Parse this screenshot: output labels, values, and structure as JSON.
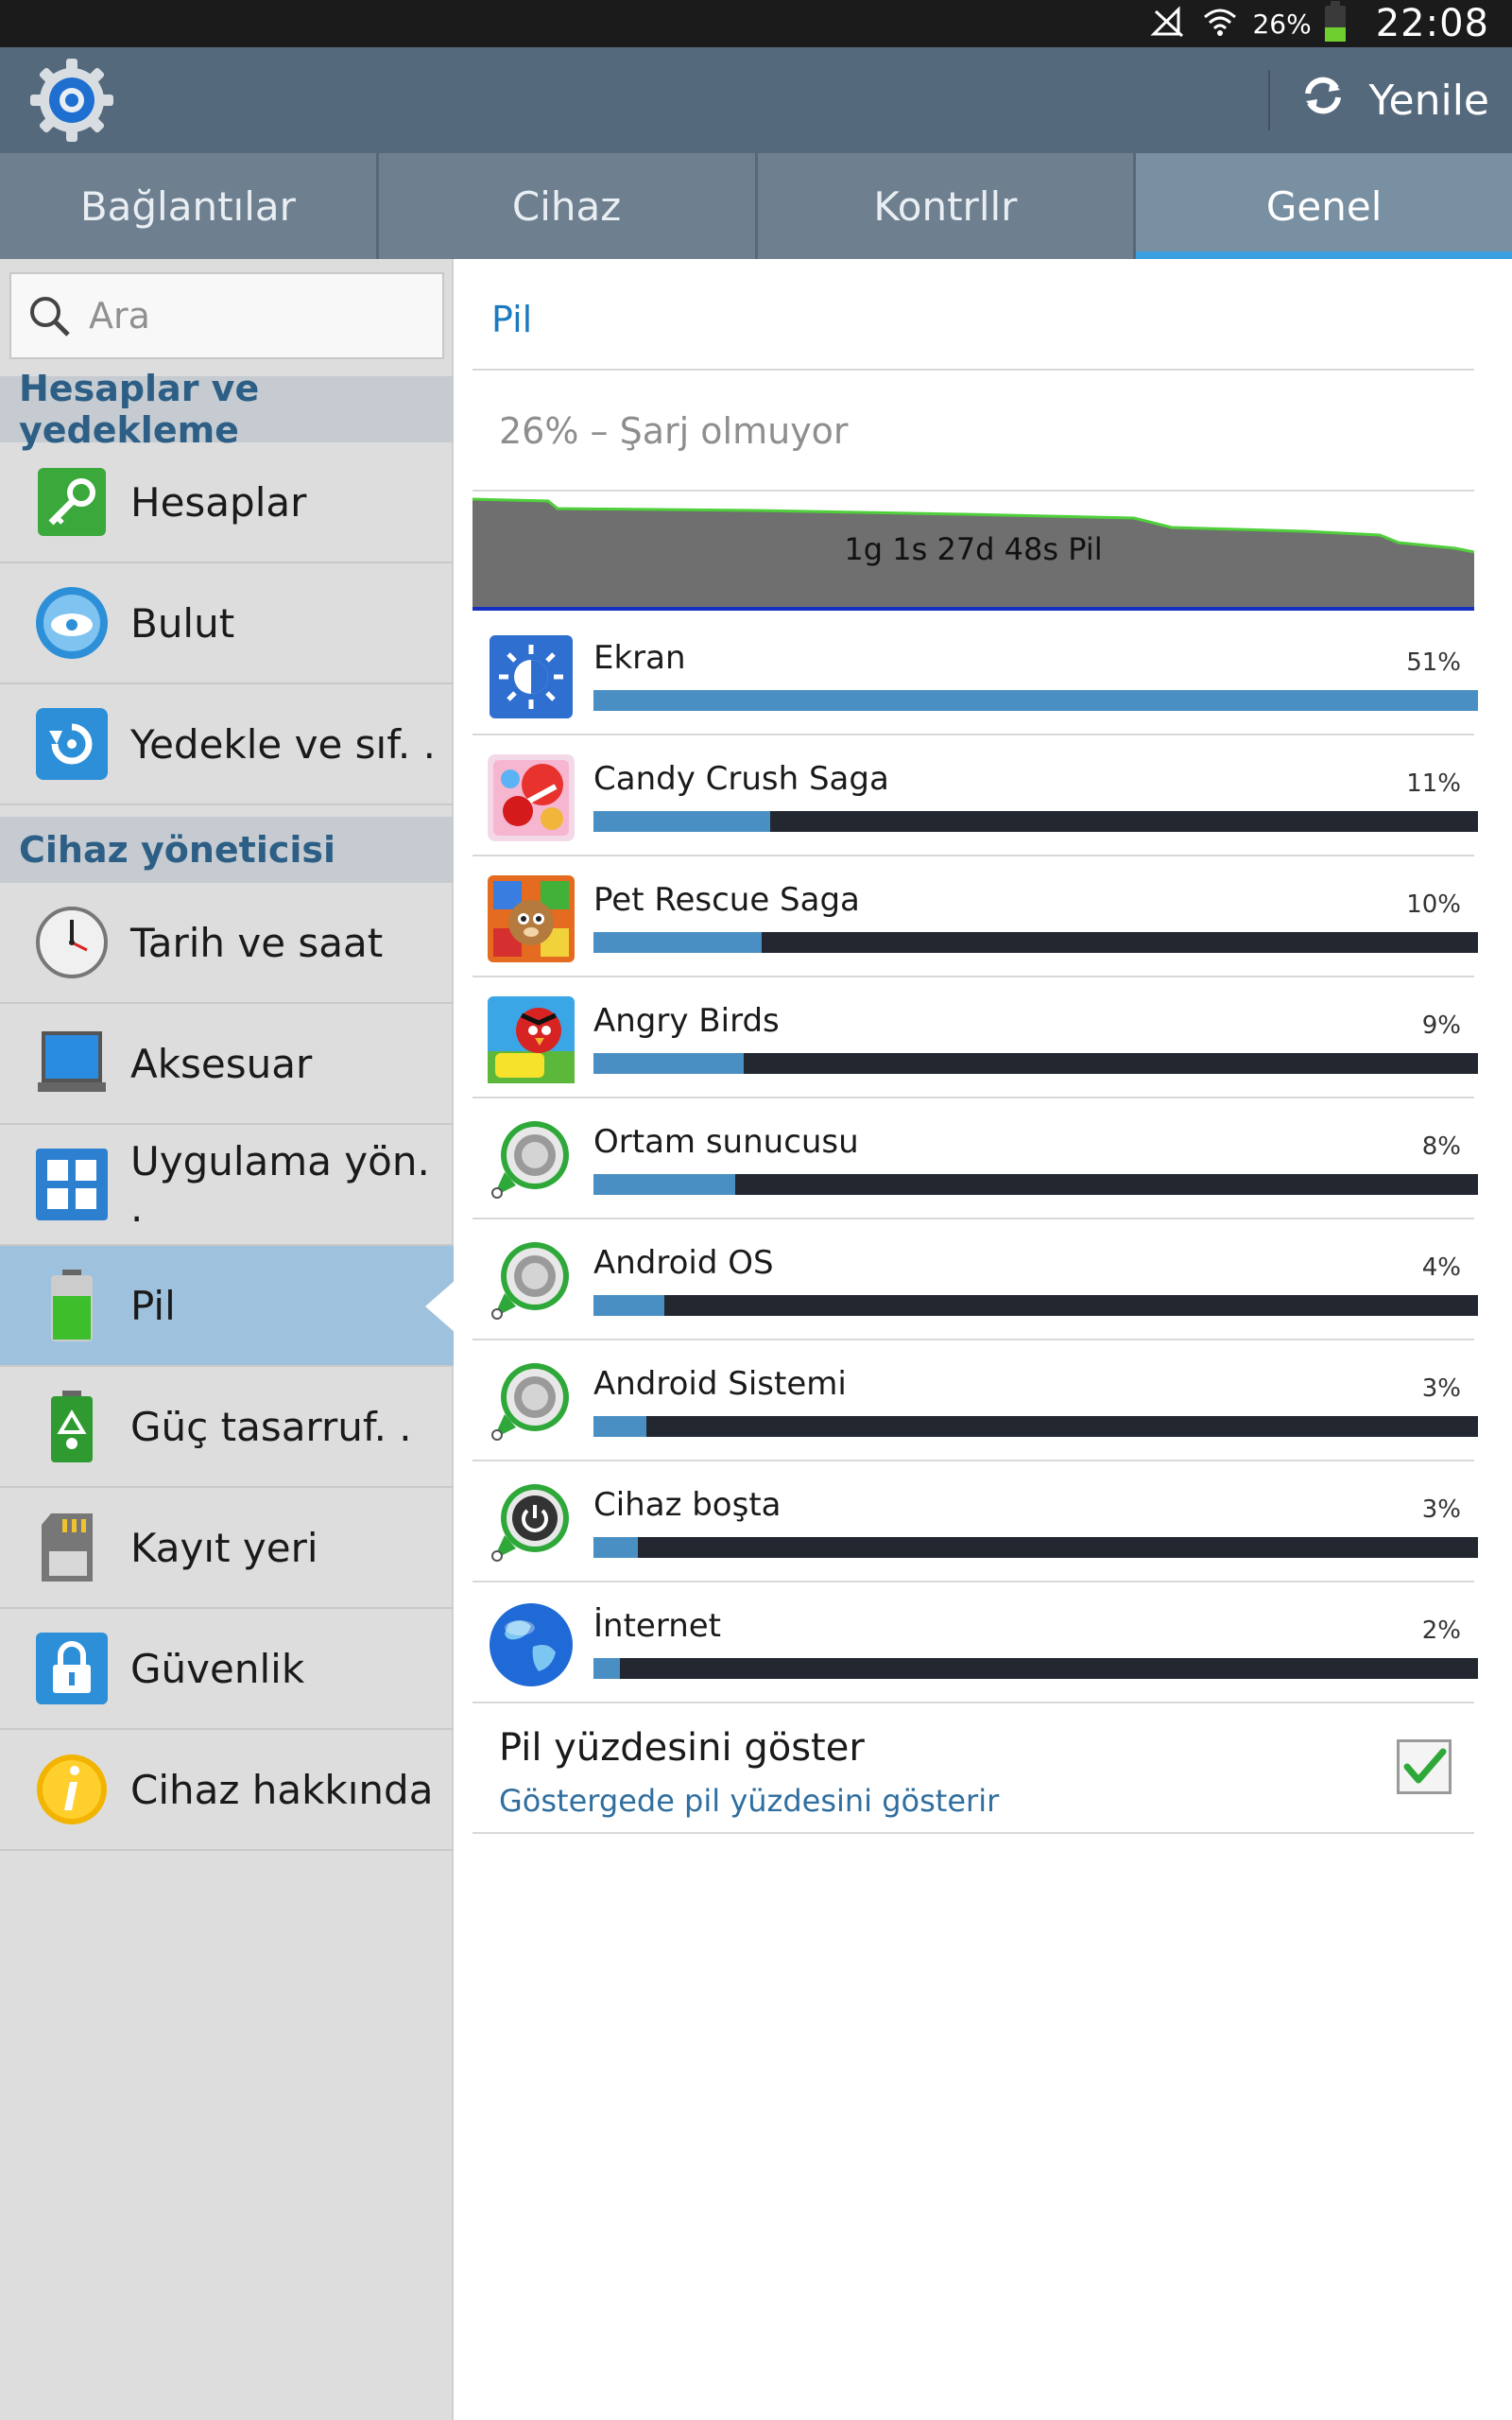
{
  "status_bar": {
    "battery_percent": "26%",
    "time": "22:08"
  },
  "action_bar": {
    "refresh_label": "Yenile"
  },
  "tabs": [
    {
      "label": "Bağlantılar"
    },
    {
      "label": "Cihaz"
    },
    {
      "label": "Kontrllr"
    },
    {
      "label": "Genel"
    }
  ],
  "search": {
    "placeholder": "Ara"
  },
  "sidebar": {
    "section1": "Hesaplar ve yedekleme",
    "section2": "Cihaz yöneticisi",
    "items": [
      {
        "label": "Hesaplar",
        "icon": "key-icon"
      },
      {
        "label": "Bulut",
        "icon": "cloud-icon"
      },
      {
        "label": "Yedekle ve sıf. .",
        "icon": "backup-icon"
      },
      {
        "label": "Tarih ve saat",
        "icon": "clock-icon"
      },
      {
        "label": "Aksesuar",
        "icon": "accessory-icon"
      },
      {
        "label": "Uygulama yön. .",
        "icon": "apps-icon"
      },
      {
        "label": "Pil",
        "icon": "battery-icon"
      },
      {
        "label": "Güç tasarruf. .",
        "icon": "power-saving-icon"
      },
      {
        "label": "Kayıt yeri",
        "icon": "storage-icon"
      },
      {
        "label": "Güvenlik",
        "icon": "lock-icon"
      },
      {
        "label": "Cihaz hakkında",
        "icon": "info-icon"
      }
    ]
  },
  "content": {
    "title": "Pil",
    "status": "26% – Şarj olmuyor",
    "graph_label": "1g 1s 27d 48s Pil",
    "apps": [
      {
        "name": "Ekran",
        "percent": "51%",
        "fraction": 1.0,
        "icon": "display-icon"
      },
      {
        "name": "Candy Crush Saga",
        "percent": "11%",
        "fraction": 0.2,
        "icon": "candy-crush-icon"
      },
      {
        "name": "Pet Rescue Saga",
        "percent": "10%",
        "fraction": 0.19,
        "icon": "pet-rescue-icon"
      },
      {
        "name": "Angry Birds",
        "percent": "9%",
        "fraction": 0.17,
        "icon": "angry-birds-icon"
      },
      {
        "name": "Ortam sunucusu",
        "percent": "8%",
        "fraction": 0.16,
        "icon": "media-server-icon"
      },
      {
        "name": "Android OS",
        "percent": "4%",
        "fraction": 0.08,
        "icon": "android-os-icon"
      },
      {
        "name": "Android Sistemi",
        "percent": "3%",
        "fraction": 0.06,
        "icon": "android-system-icon"
      },
      {
        "name": "Cihaz boşta",
        "percent": "3%",
        "fraction": 0.05,
        "icon": "device-idle-icon"
      },
      {
        "name": "İnternet",
        "percent": "2%",
        "fraction": 0.03,
        "icon": "internet-icon"
      }
    ],
    "pref_title": "Pil yüzdesini göster",
    "pref_subtitle": "Göstergede pil yüzdesini gösterir",
    "pref_checked": true
  },
  "colors": {
    "accent": "#1c7ac0",
    "bar_fill": "#4a8fc3",
    "bar_track": "#222730",
    "header": "#55697d"
  }
}
